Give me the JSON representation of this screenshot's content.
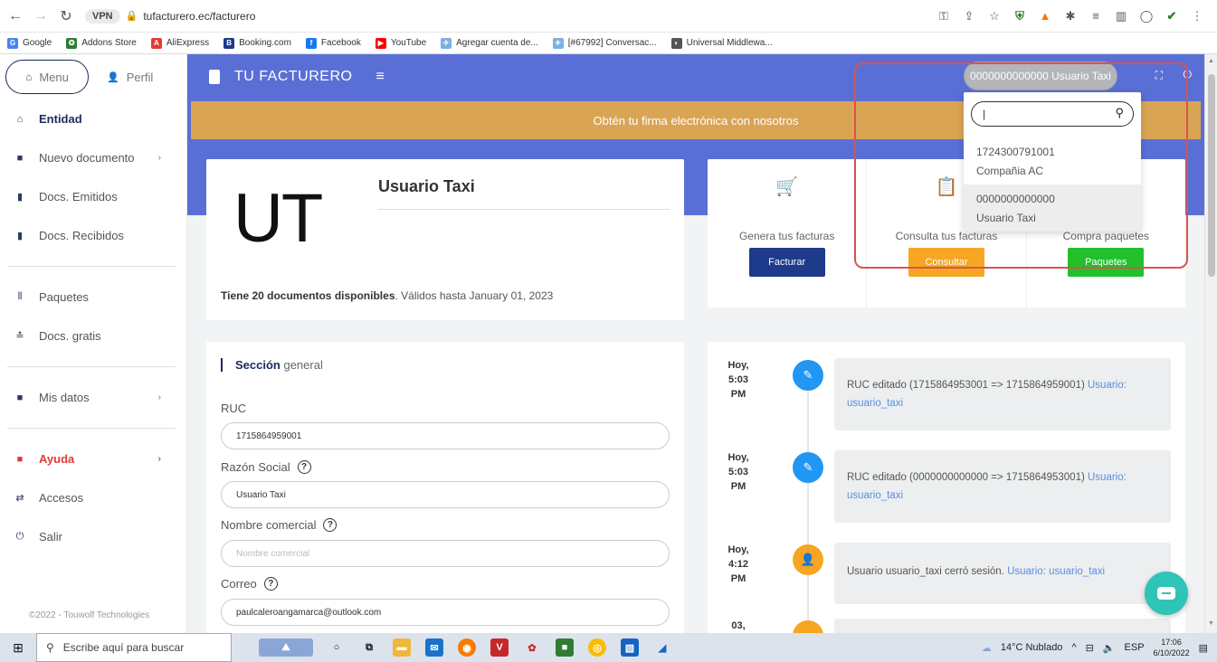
{
  "browser": {
    "vpn": "VPN",
    "url": "tufacturero.ec/facturero",
    "bookmarks": [
      {
        "label": "Google",
        "color": "#4285f4",
        "glyph": "G"
      },
      {
        "label": "Addons Store",
        "color": "#2e7d32",
        "glyph": "✪"
      },
      {
        "label": "AliExpress",
        "color": "#e53935",
        "glyph": "A"
      },
      {
        "label": "Booking.com",
        "color": "#1a3a8e",
        "glyph": "B"
      },
      {
        "label": "Facebook",
        "color": "#1877f2",
        "glyph": "f"
      },
      {
        "label": "YouTube",
        "color": "#ff0000",
        "glyph": "▶"
      },
      {
        "label": "Agregar cuenta de...",
        "color": "#7ab0e0",
        "glyph": "✈"
      },
      {
        "label": "[#67992] Conversac...",
        "color": "#7ab0e0",
        "glyph": "✈"
      },
      {
        "label": "Universal Middlewa...",
        "color": "#555555",
        "glyph": "◐"
      }
    ]
  },
  "sidebar": {
    "menu_label": "Menu",
    "perfil_label": "Perfil",
    "items_a": [
      {
        "label": "Entidad",
        "icon": "home-icon",
        "glyph": "⌂"
      },
      {
        "label": "Nuevo documento",
        "icon": "plus-square-icon",
        "glyph": "■"
      },
      {
        "label": "Docs. Emitidos",
        "icon": "clipboard-icon",
        "glyph": "▮"
      },
      {
        "label": "Docs. Recibidos",
        "icon": "clipboard-icon",
        "glyph": "▮"
      }
    ],
    "items_b": [
      {
        "label": "Paquetes",
        "icon": "bars-icon",
        "glyph": "⦀"
      },
      {
        "label": "Docs. gratis",
        "icon": "gift-icon",
        "glyph": "≛"
      }
    ],
    "items_c": [
      {
        "label": "Mis datos",
        "icon": "user-square-icon",
        "glyph": "■"
      }
    ],
    "items_d": [
      {
        "label": "Ayuda",
        "icon": "help-square-icon",
        "glyph": "■"
      },
      {
        "label": "Accesos",
        "icon": "exchange-icon",
        "glyph": "⇄"
      },
      {
        "label": "Salir",
        "icon": "power-icon",
        "glyph": "⏻"
      }
    ],
    "footer": "©2022 - Touwolf Technologies"
  },
  "topbar": {
    "brand": "TU FACTURERO",
    "user_selector": "0000000000000 Usuario Taxi"
  },
  "banner": "Obtén tu firma electrónica con nosotros",
  "profile": {
    "initials": "UT",
    "name": "Usuario Taxi",
    "docs_bold": "Tiene 20 documentos disponibles",
    "docs_rest": ". Válidos hasta January 01, 2023"
  },
  "actions": [
    {
      "label": "Genera tus facturas",
      "button": "Facturar",
      "color": "#1e3a8a",
      "icon_color": "#2196f3",
      "glyph": "🛒"
    },
    {
      "label": "Consulta tus facturas",
      "button": "Consultar",
      "color": "#f6a623",
      "icon_color": "#f6a623",
      "glyph": "📋"
    },
    {
      "label": "Compra paquetes",
      "button": "Paquetes",
      "color": "#22c12c",
      "icon_color": "#22c12c",
      "glyph": "▣"
    }
  ],
  "form": {
    "section_bold": "Sección",
    "section_rest": " general",
    "ruc_label": "RUC",
    "ruc_value": "1715864959001",
    "razon_label": "Razón Social",
    "razon_value": "Usuario Taxi",
    "nombre_label": "Nombre comercial",
    "nombre_placeholder": "Nombre comercial",
    "correo_label": "Correo",
    "correo_value": "paulcaleroangamarca@outlook.com"
  },
  "timeline": [
    {
      "time": [
        "Hoy,",
        "5:03",
        "PM"
      ],
      "text": "RUC editado (1715864953001 => 1715864959001) ",
      "user": "Usuario: usuario_taxi",
      "color": "#2196f3",
      "glyph": "✎"
    },
    {
      "time": [
        "Hoy,",
        "5:03",
        "PM"
      ],
      "text": "RUC editado (0000000000000 => 1715864953001) ",
      "user": "Usuario: usuario_taxi",
      "color": "#2196f3",
      "glyph": "✎"
    },
    {
      "time": [
        "Hoy,",
        "4:12",
        "PM"
      ],
      "text": "Usuario usuario_taxi cerró sesión. ",
      "user": "Usuario: usuario_taxi",
      "color": "#f6a623",
      "glyph": "👤"
    },
    {
      "time": [
        "03,",
        "",
        ""
      ],
      "text": "",
      "user": "",
      "color": "#f6a623",
      "glyph": ""
    }
  ],
  "dropdown": {
    "search_value": "|",
    "options": [
      {
        "id": "1724300791001",
        "name": "Compañia AC"
      },
      {
        "id": "0000000000000",
        "name": "Usuario Taxi"
      }
    ]
  },
  "taskbar": {
    "search_placeholder": "Escribe aquí para buscar",
    "weather": "14°C  Nublado",
    "lang": "ESP",
    "time": "17:06",
    "date": "6/10/2022"
  }
}
